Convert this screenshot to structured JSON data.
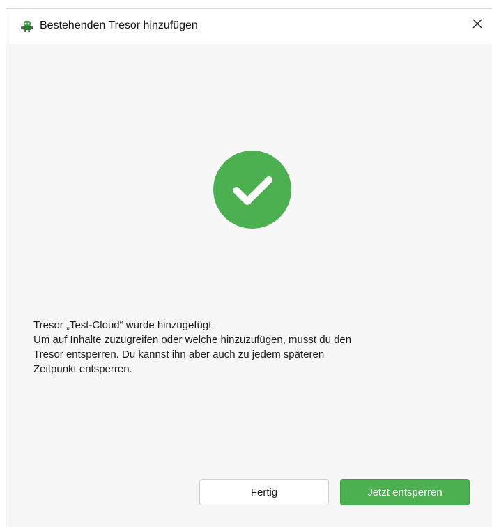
{
  "window": {
    "title": "Bestehenden Tresor hinzufügen",
    "close_glyph": "✕",
    "app_icon": "cryptomator-bot-icon"
  },
  "status": {
    "icon": "check-circle-icon",
    "color": "#4caf50"
  },
  "message": {
    "lines": [
      "Tresor „Test-Cloud“ wurde hinzugefügt.",
      "Um auf Inhalte zuzugreifen oder welche hinzuzufügen, musst du den",
      "Tresor entsperren. Du kannst ihn aber auch zu jedem späteren",
      "Zeitpunkt entsperren."
    ]
  },
  "buttons": {
    "done_label": "Fertig",
    "unlock_label": "Jetzt entsperren"
  },
  "colors": {
    "accent": "#4caf50",
    "background": "#f7f7f7"
  }
}
